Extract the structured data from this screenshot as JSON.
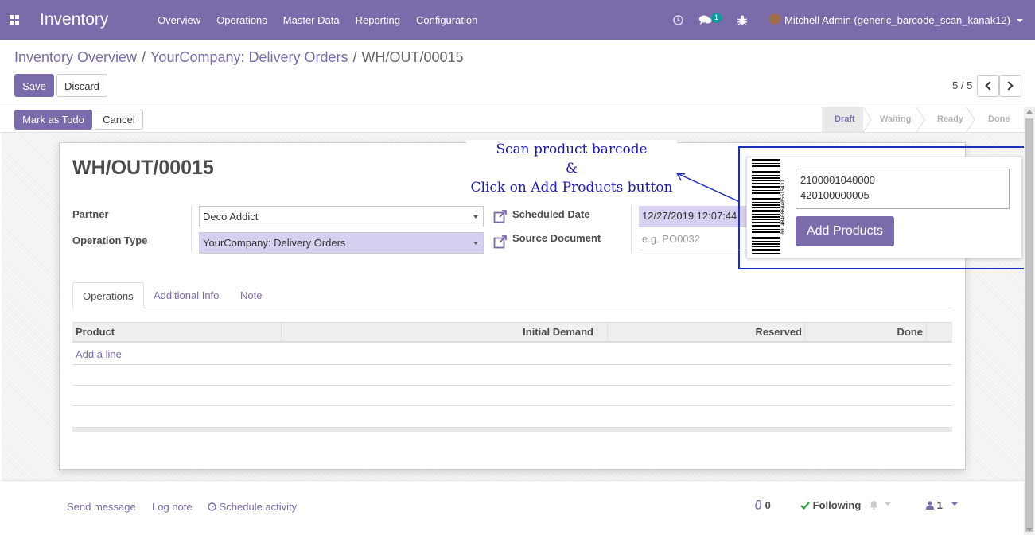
{
  "navbar": {
    "brand": "Inventory",
    "menu": [
      "Overview",
      "Operations",
      "Master Data",
      "Reporting",
      "Configuration"
    ],
    "chat_badge": "1",
    "user": "Mitchell Admin (generic_barcode_scan_kanak12)"
  },
  "breadcrumb": {
    "items": [
      "Inventory Overview",
      "YourCompany: Delivery Orders"
    ],
    "separator": "/",
    "current": "WH/OUT/00015"
  },
  "controls": {
    "save": "Save",
    "discard": "Discard",
    "pager": "5 / 5"
  },
  "statusbar": {
    "mark_todo": "Mark as Todo",
    "cancel": "Cancel",
    "stages": [
      "Draft",
      "Waiting",
      "Ready",
      "Done"
    ],
    "current_stage": "Draft"
  },
  "form": {
    "name": "WH/OUT/00015",
    "partner_label": "Partner",
    "partner_value": "Deco Addict",
    "operation_type_label": "Operation Type",
    "operation_type_value": "YourCompany: Delivery Orders",
    "scheduled_date_label": "Scheduled Date",
    "scheduled_date_value": "12/27/2019 12:07:44",
    "source_document_label": "Source Document",
    "source_document_placeholder": "e.g. PO0032"
  },
  "tabs": [
    "Operations",
    "Additional Info",
    "Note"
  ],
  "table": {
    "columns": [
      "Product",
      "Initial Demand",
      "Reserved",
      "Done"
    ],
    "add_line": "Add a line"
  },
  "annotation": {
    "line1": "Scan product barcode",
    "line2": "&",
    "line3": "Click on Add Products button"
  },
  "barcode_popup": {
    "barcode_number": "0014040060405615431",
    "scanned_text": "2100001040000\n420100000005",
    "add_products": "Add Products"
  },
  "chatter": {
    "send_message": "Send message",
    "log_note": "Log note",
    "schedule_activity": "Schedule activity",
    "attachments": "0",
    "following": "Following",
    "followers": "1"
  },
  "colors": {
    "brand": "#7c6bab",
    "annotation": "#1a1ab8",
    "highlight": "#d8d0f0"
  }
}
